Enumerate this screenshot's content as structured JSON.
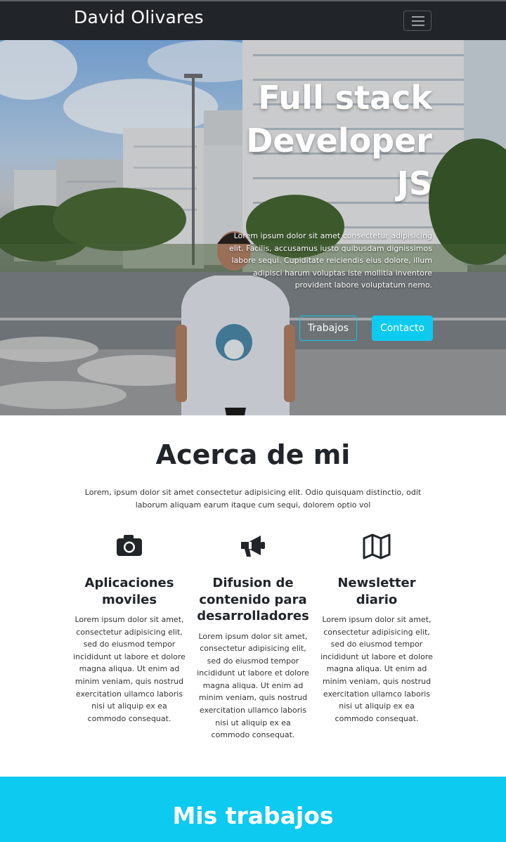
{
  "navbar": {
    "brand": "David Olivares",
    "menu_icon": "hamburger-menu-icon"
  },
  "hero": {
    "title": "Full stack Developer JS",
    "lead": "Lorem ipsum dolor sit amet consectetur adipisicing elit. Facilis, accusamus iusto quibusdam dignissimos labore sequi. Cupiditate reiciendis eius dolore, illum adipisci harum voluptas iste mollitia inventore provident labore voluptatum nemo.",
    "btn_works": "Trabajos",
    "btn_contact": "Contacto",
    "accent": "#0dcaf0"
  },
  "about": {
    "title": "Acerca de mi",
    "lead": "Lorem, ipsum dolor sit amet consectetur adipisicing elit. Odio quisquam distinctio, odit laborum aliquam earum itaque cum sequi, dolorem optio vol",
    "features": [
      {
        "icon": "camera-icon",
        "title": "Aplicaciones moviles",
        "text": "Lorem ipsum dolor sit amet, consectetur adipisicing elit, sed do eiusmod tempor incididunt ut labore et dolore magna aliqua. Ut enim ad minim veniam, quis nostrud exercitation ullamco laboris nisi ut aliquip ex ea commodo consequat."
      },
      {
        "icon": "megaphone-icon",
        "title": "Difusion de contenido para desarrolladores",
        "text": "Lorem ipsum dolor sit amet, consectetur adipisicing elit, sed do eiusmod tempor incididunt ut labore et dolore magna aliqua. Ut enim ad minim veniam, quis nostrud exercitation ullamco laboris nisi ut aliquip ex ea commodo consequat."
      },
      {
        "icon": "map-icon",
        "title": "Newsletter diario",
        "text": "Lorem ipsum dolor sit amet, consectetur adipisicing elit, sed do eiusmod tempor incididunt ut labore et dolore magna aliqua. Ut enim ad minim veniam, quis nostrud exercitation ullamco laboris nisi ut aliquip ex ea commodo consequat."
      }
    ]
  },
  "works": {
    "title": "Mis trabajos"
  }
}
